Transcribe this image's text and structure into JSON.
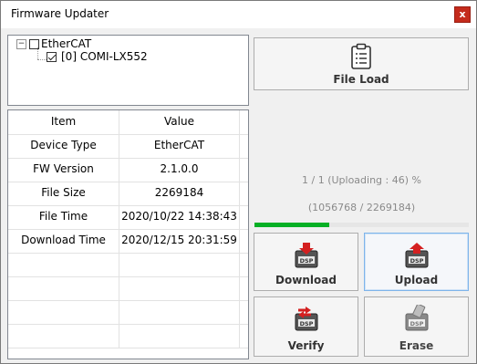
{
  "window": {
    "title": "Firmware Updater",
    "close_glyph": "x"
  },
  "tree": {
    "root": {
      "label": "EtherCAT",
      "expander": "⊟",
      "checked": false
    },
    "child": {
      "label": "[0] COMI-LX552",
      "checked": true
    }
  },
  "table": {
    "headers": [
      "Item",
      "Value"
    ],
    "rows": [
      [
        "Device Type",
        "EtherCAT"
      ],
      [
        "FW Version",
        "2.1.0.0"
      ],
      [
        "File Size",
        "2269184"
      ],
      [
        "File Time",
        "2020/10/22 14:38:43"
      ],
      [
        "Download Time",
        "2020/12/15 20:31:59"
      ]
    ]
  },
  "file_load": {
    "label": "File Load",
    "icon": "clipboard-list-icon"
  },
  "status": {
    "line1": "1 / 1 (Uploading : 46) %",
    "line2": "(1056768 / 2269184)",
    "progress_percent": 35
  },
  "actions": {
    "download": {
      "label": "Download",
      "icon": "dsp-download-icon"
    },
    "upload": {
      "label": "Upload",
      "icon": "dsp-upload-icon"
    },
    "verify": {
      "label": "Verify",
      "icon": "dsp-verify-icon"
    },
    "erase": {
      "label": "Erase",
      "icon": "dsp-erase-icon"
    }
  },
  "colors": {
    "progress": "#06b025",
    "arrow_red": "#d42020",
    "close_red": "#c42b1c"
  }
}
